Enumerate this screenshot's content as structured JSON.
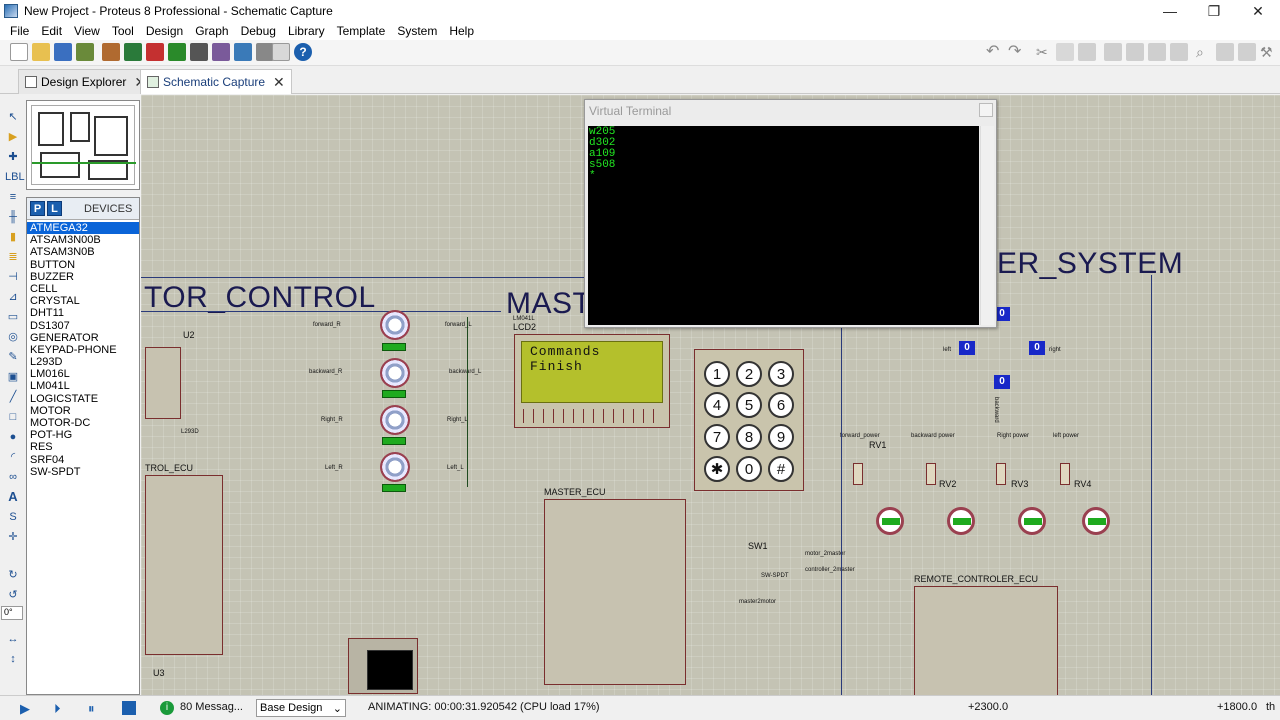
{
  "window": {
    "title": "New Project - Proteus 8 Professional - Schematic Capture"
  },
  "menu": [
    "File",
    "Edit",
    "View",
    "Tool",
    "Design",
    "Graph",
    "Debug",
    "Library",
    "Template",
    "System",
    "Help"
  ],
  "tabs": [
    {
      "label": "Design Explorer"
    },
    {
      "label": "Schematic Capture"
    }
  ],
  "devices": {
    "title": "DEVICES",
    "p_label": "P",
    "l_label": "L",
    "items": [
      "ATMEGA32",
      "ATSAM3N00B",
      "ATSAM3N0B",
      "BUTTON",
      "BUZZER",
      "CELL",
      "CRYSTAL",
      "DHT11",
      "DS1307",
      "GENERATOR",
      "KEYPAD-PHONE",
      "L293D",
      "LM016L",
      "LM041L",
      "LOGICSTATE",
      "MOTOR",
      "MOTOR-DC",
      "POT-HG",
      "RES",
      "SRF04",
      "SW-SPDT"
    ],
    "selected": "ATMEGA32"
  },
  "left_tools": {
    "angle_value": "0°"
  },
  "schematic": {
    "motor_control_title": "TOR_CONTROL",
    "master_title": "MAST",
    "system_title": "ER_SYSTEM",
    "u2": "U2",
    "u3": "U3",
    "l293d": "L293D",
    "motor_ecu": "TROL_ECU",
    "master_ecu": "MASTER_ECU",
    "remote_ecu": "REMOTE_CONTROLER_ECU",
    "lcd2": "LCD2",
    "lcd_ref": "LM041L",
    "lcd_text": "Commands Finish",
    "sw1": "SW1",
    "sw_ref": "SW-SPDT",
    "rv": [
      "RV1",
      "RV2",
      "RV3",
      "RV4"
    ],
    "pot_labels": [
      "forward_power",
      "backward power",
      "Right power",
      "left power"
    ],
    "motor_labels_left": [
      "forward_R",
      "backward_R",
      "Right_R",
      "Left_R"
    ],
    "motor_labels_right": [
      "forward_L",
      "backward_L",
      "Right_L",
      "Left_L"
    ],
    "keypad_keys": [
      "1",
      "2",
      "3",
      "4",
      "5",
      "6",
      "7",
      "8",
      "9",
      "✱",
      "0",
      "#"
    ],
    "dir_values": [
      "0",
      "0",
      "0",
      "0"
    ],
    "dir_labels": [
      "left",
      "right",
      "backward"
    ],
    "sw_outputs": [
      "motor_2master",
      "controller_2master"
    ],
    "master_to_motor": "master2motor"
  },
  "virtual_terminal": {
    "title": "Virtual Terminal",
    "lines": [
      "w205",
      "d302",
      "a109",
      "s508",
      "*"
    ]
  },
  "status": {
    "messages": "80 Messag...",
    "design": "Base Design",
    "animating": "ANIMATING: 00:00:31.920542 (CPU load 17%)",
    "x_coord": "+2300.0",
    "y_coord": "+1800.0",
    "units": "th"
  },
  "colors": {
    "accent": "#0a64d8",
    "grid_bg": "#c4c3b4",
    "terminal_text": "#22e822",
    "lcd_bg": "#b4c02c"
  }
}
